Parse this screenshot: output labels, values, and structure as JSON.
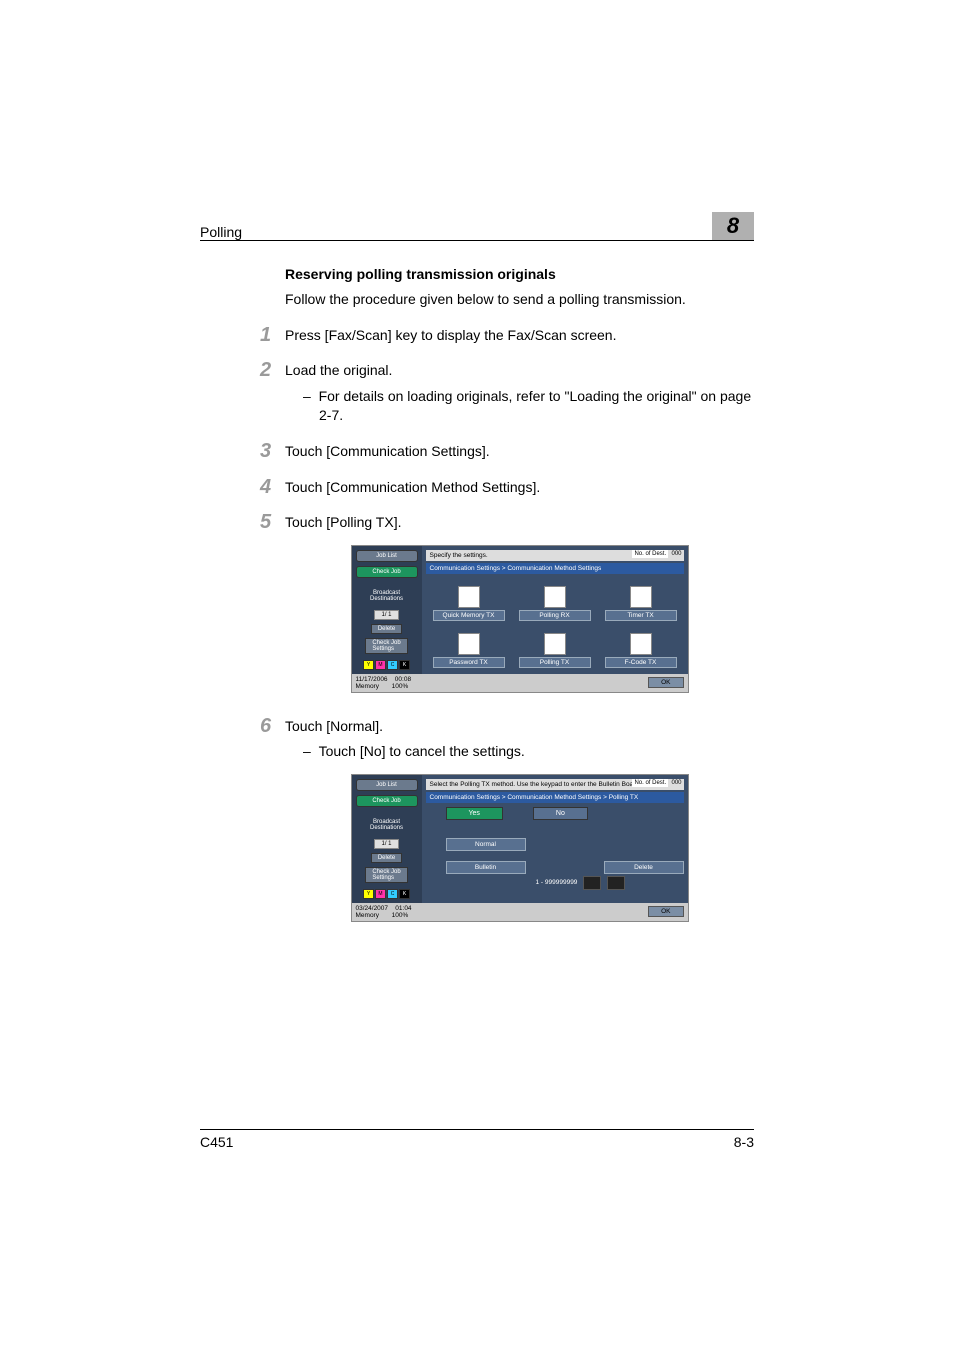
{
  "header": {
    "section_title": "Polling",
    "chapter_number": "8"
  },
  "body": {
    "subheading": "Reserving polling transmission originals",
    "intro": "Follow the procedure given below to send a polling transmission.",
    "step1": {
      "num": "1",
      "text": "Press [Fax/Scan] key to display the Fax/Scan screen."
    },
    "step2": {
      "num": "2",
      "text": "Load the original.",
      "bullet": "For details on loading originals, refer to \"Loading the original\" on page 2-7."
    },
    "step3": {
      "num": "3",
      "text": "Touch [Communication Settings]."
    },
    "step4": {
      "num": "4",
      "text": "Touch [Communication Method Settings]."
    },
    "step5": {
      "num": "5",
      "text": "Touch [Polling TX]."
    },
    "step6": {
      "num": "6",
      "text": "Touch [Normal].",
      "bullet": "Touch [No] to cancel the settings."
    }
  },
  "shot1": {
    "job_list": "Job List",
    "check_job": "Check Job",
    "broadcast": "Broadcast\nDestinations",
    "pager": "1/  1",
    "delete": "Delete",
    "check": "Check Job\nSettings",
    "instr": "Specify the settings.",
    "noof_label": "No. of Dest.",
    "noof_value": "000",
    "crumb": "Communication Settings > Communication Method Settings",
    "icons": {
      "quick_memory": "Quick Memory TX",
      "polling_rx": "Polling RX",
      "timer_tx": "Timer TX",
      "password_tx": "Password TX",
      "polling_tx": "Polling TX",
      "fcode_tx": "F-Code TX"
    },
    "footer_date": "11/17/2006",
    "footer_time": "00:08",
    "footer_mem": "Memory",
    "footer_pct": "100%",
    "ok": "OK",
    "toner": {
      "y": "Y",
      "m": "M",
      "c": "C",
      "k": "K"
    }
  },
  "shot2": {
    "job_list": "Job List",
    "check_job": "Check Job",
    "broadcast": "Broadcast\nDestinations",
    "pager": "1/  1",
    "delete": "Delete",
    "check": "Check Job\nSettings",
    "instr": "Select the Polling TX method. Use the keypad to enter the Bulletin Board number.",
    "noof_label": "No. of Dest.",
    "noof_value": "000",
    "crumb": "Communication Settings > Communication Method Settings > Polling TX",
    "yes": "Yes",
    "no": "No",
    "normal": "Normal",
    "bulletin": "Bulletin",
    "delete2": "Delete",
    "range": "1 - 999999999",
    "footer_date": "03/24/2007",
    "footer_time": "01:04",
    "footer_mem": "Memory",
    "footer_pct": "100%",
    "ok": "OK"
  },
  "footer": {
    "model": "C451",
    "page": "8-3"
  }
}
